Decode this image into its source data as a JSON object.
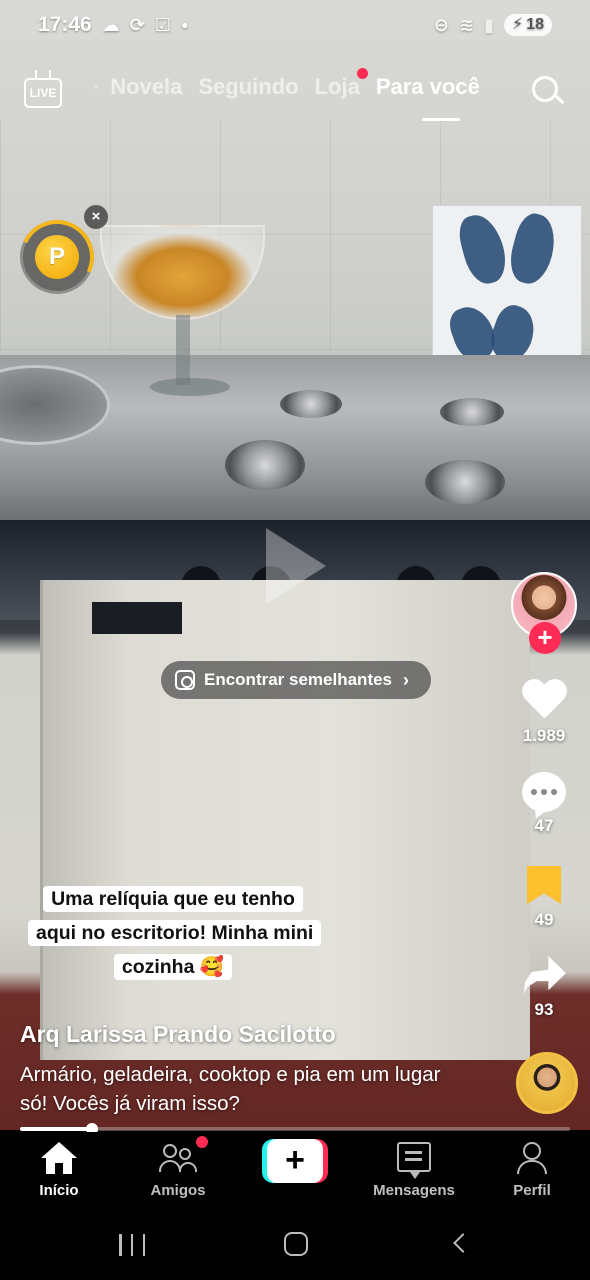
{
  "status_bar": {
    "time": "17:46",
    "battery": "18",
    "left_icons": [
      "cloud-icon",
      "sync-icon",
      "check-square-icon",
      "dot-icon"
    ],
    "right_icons": [
      "dnd-icon",
      "wifi-icon",
      "signal-icon",
      "battery-icon"
    ]
  },
  "top_nav": {
    "live_label": "LIVE",
    "tabs": [
      {
        "label": "Novela",
        "active": false
      },
      {
        "label": "Seguindo",
        "active": false
      },
      {
        "label": "Loja",
        "active": false,
        "has_dot": true
      },
      {
        "label": "Para você",
        "active": true
      }
    ],
    "search_icon": "search-icon"
  },
  "coin_widget": {
    "coin_letter": "P",
    "close_symbol": "×"
  },
  "find_similar": {
    "label": "Encontrar semelhantes",
    "chevron": "›"
  },
  "video": {
    "sticker_text": "Uma relíquia que eu tenho aqui no escritorio! Minha mini cozinha 🥰",
    "author": "Arq Larissa Prando Sacilotto",
    "description": "Armário, geladeira, cooktop e pia em um lugar só! Vocês já viram isso?",
    "progress": 0.13
  },
  "actions": {
    "follow_symbol": "+",
    "likes": "1.989",
    "comments": "47",
    "saves": "49",
    "shares": "93"
  },
  "bottom_nav": {
    "items": [
      {
        "label": "Início",
        "icon": "home-icon",
        "active": true
      },
      {
        "label": "Amigos",
        "icon": "friends-icon",
        "active": false,
        "has_dot": true
      },
      {
        "label": "",
        "icon": "create-icon",
        "active": false
      },
      {
        "label": "Mensagens",
        "icon": "inbox-icon",
        "active": false
      },
      {
        "label": "Perfil",
        "icon": "profile-icon",
        "active": false
      }
    ],
    "create_symbol": "+"
  },
  "colors": {
    "accent_red": "#fe2c55",
    "accent_cyan": "#25f4ee",
    "bookmark_yellow": "#fbc02d",
    "coin_gold": "#f6b71b"
  }
}
